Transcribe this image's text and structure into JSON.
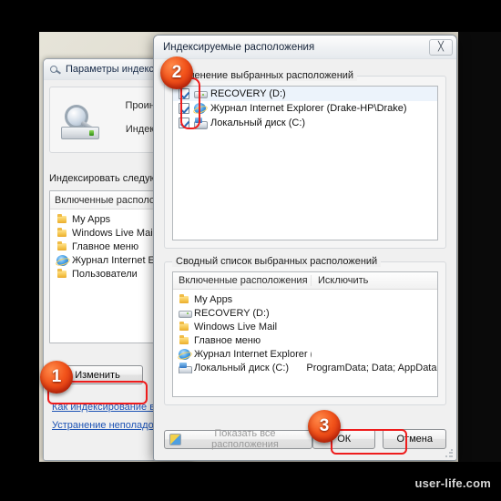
{
  "watermark": "user-life.com",
  "background_window": {
    "title": "Параметры индексирования",
    "icon": "indexing-options-icon",
    "info_rows": [
      {
        "label": "Проиндекси"
      },
      {
        "label": "Индексиров"
      }
    ],
    "section_label": "Индексировать следующие",
    "list": {
      "header": "Включенные расположени",
      "items": [
        {
          "icon": "folder-icon",
          "label": "My Apps"
        },
        {
          "icon": "folder-icon",
          "label": "Windows Live Mail"
        },
        {
          "icon": "folder-icon",
          "label": "Главное меню"
        },
        {
          "icon": "internet-explorer-icon",
          "label": "Журнал Internet Explore"
        },
        {
          "icon": "folder-icon",
          "label": "Пользователи"
        }
      ]
    },
    "change_button": "Изменить",
    "links": [
      "Как индексирование влияет",
      "Устранение неполадок при и"
    ]
  },
  "dialog": {
    "title": "Индексируемые расположения",
    "close_icon": "close-icon",
    "group_top": {
      "label": "Изменение выбранных расположений",
      "items": [
        {
          "checked": true,
          "icon": "drive-icon",
          "label": "RECOVERY (D:)",
          "selected": true
        },
        {
          "checked": true,
          "icon": "internet-explorer-icon",
          "label": "Журнал Internet Explorer (Drake-HP\\Drake)",
          "selected": false
        },
        {
          "checked": true,
          "icon": "system-drive-icon",
          "label": "Локальный диск (C:)",
          "selected": false
        }
      ]
    },
    "group_bottom": {
      "label": "Сводный список выбранных расположений",
      "columns": [
        "Включенные расположения",
        "Исключить"
      ],
      "rows": [
        {
          "icon": "folder-icon",
          "included": "My Apps",
          "excluded": ""
        },
        {
          "icon": "drive-icon",
          "included": "RECOVERY (D:)",
          "excluded": ""
        },
        {
          "icon": "folder-icon",
          "included": "Windows Live Mail",
          "excluded": ""
        },
        {
          "icon": "folder-icon",
          "included": "Главное меню",
          "excluded": ""
        },
        {
          "icon": "internet-explorer-icon",
          "included": "Журнал Internet Explorer (…",
          "excluded": ""
        },
        {
          "icon": "system-drive-icon",
          "included": "Локальный диск (C:)",
          "excluded": "ProgramData; Data; AppData;…"
        }
      ]
    },
    "footer": {
      "show_all": "Показать все расположения",
      "show_all_disabled": true,
      "ok": "ОК",
      "cancel": "Отмена"
    }
  },
  "annotations": {
    "badges": [
      {
        "number": "1",
        "target": "change-button"
      },
      {
        "number": "2",
        "target": "location-checkboxes"
      },
      {
        "number": "3",
        "target": "ok-button"
      }
    ],
    "highlight_color": "#ee1c1c"
  }
}
